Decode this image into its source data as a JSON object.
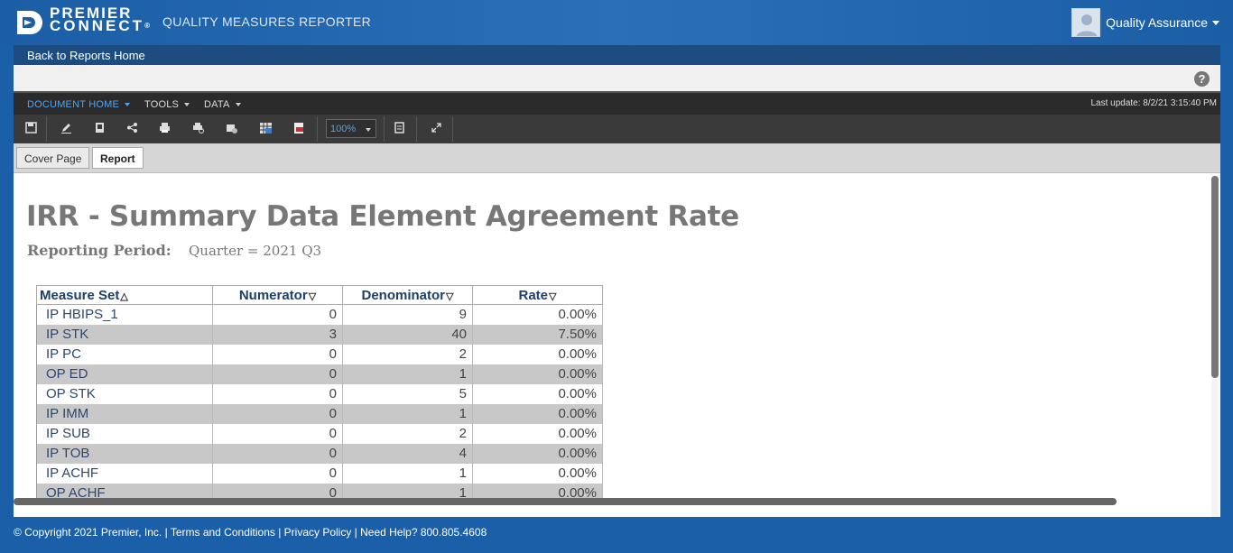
{
  "header": {
    "brand_line1": "PREMIER",
    "brand_line2": "CONNECT",
    "brand_mark": "®",
    "app_title": "QUALITY MEASURES REPORTER",
    "user_name": "Quality Assurance"
  },
  "nav": {
    "back_link": "Back to Reports Home"
  },
  "menu": {
    "items": [
      "DOCUMENT HOME",
      "TOOLS",
      "DATA"
    ],
    "last_update": "Last update: 8/2/21 3:15:40 PM"
  },
  "toolbar": {
    "zoom": "100%",
    "icons": [
      "save-icon",
      "edit-icon",
      "bookmark-icon",
      "share-icon",
      "print-icon",
      "print-preview-icon",
      "export-icon",
      "excel-icon",
      "pdf-icon",
      "calculator-icon",
      "fullscreen-icon"
    ]
  },
  "tabs": [
    "Cover Page",
    "Report"
  ],
  "report": {
    "title": "IRR - Summary Data Element Agreement Rate",
    "period_label": "Reporting Period:",
    "period_value": "Quarter = 2021 Q3",
    "columns": [
      "Measure Set",
      "Numerator",
      "Denominator",
      "Rate"
    ],
    "rows": [
      [
        "IP HBIPS_1",
        "0",
        "9",
        "0.00%"
      ],
      [
        "IP STK",
        "3",
        "40",
        "7.50%"
      ],
      [
        "IP PC",
        "0",
        "2",
        "0.00%"
      ],
      [
        "OP ED",
        "0",
        "1",
        "0.00%"
      ],
      [
        "OP STK",
        "0",
        "5",
        "0.00%"
      ],
      [
        "IP IMM",
        "0",
        "1",
        "0.00%"
      ],
      [
        "IP SUB",
        "0",
        "2",
        "0.00%"
      ],
      [
        "IP TOB",
        "0",
        "4",
        "0.00%"
      ],
      [
        "IP ACHF",
        "0",
        "1",
        "0.00%"
      ],
      [
        "OP ACHF",
        "0",
        "1",
        "0.00%"
      ]
    ]
  },
  "footer": {
    "text": "© Copyright 2021 Premier, Inc. | Terms and Conditions | Privacy Policy | Need Help? 800.805.4608"
  },
  "colors": {
    "brand_blue": "#1b5ea6",
    "nav_dark": "#1d4d80",
    "accent": "#4ea3f0",
    "alt_row": "#c8c8c8"
  }
}
